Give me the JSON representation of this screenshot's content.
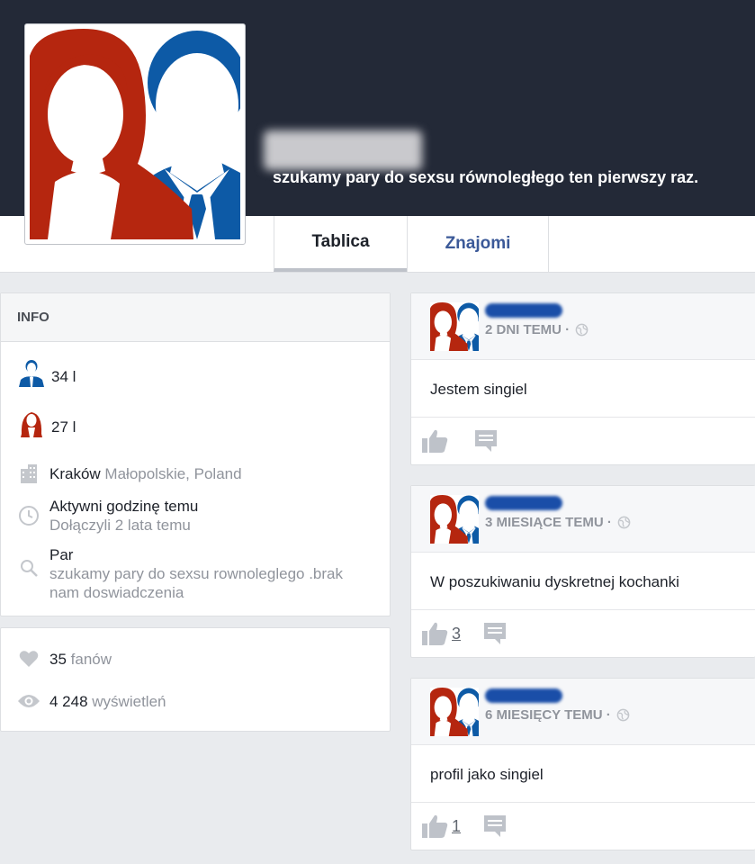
{
  "profile": {
    "tagline": "szukamy pary do sexsu równoległego ten pierwszy raz.",
    "colors": {
      "cover": "#232937",
      "woman": "#b5260f",
      "man": "#0d5aa6",
      "link": "#3b5998"
    }
  },
  "tabs": {
    "wall": "Tablica",
    "friends": "Znajomi"
  },
  "info": {
    "header": "INFO",
    "male_age": "34 l",
    "female_age": "27 l",
    "city": "Kraków",
    "region": "Małopolskie, Poland",
    "active": "Aktywni godzinę temu",
    "joined": "Dołączyli 2 lata temu",
    "type": "Par",
    "description": "szukamy pary do sexsu rownoleglego .brak nam doswiadczenia"
  },
  "stats": {
    "fans_count": "35",
    "fans_label": "fanów",
    "views_count": "4 248",
    "views_label": "wyświetleń"
  },
  "posts": [
    {
      "time": "2 DNI TEMU ·",
      "text": "Jestem singiel",
      "likes": ""
    },
    {
      "time": "3 MIESIĄCE TEMU ·",
      "text": "W poszukiwaniu dyskretnej kochanki",
      "likes": "3"
    },
    {
      "time": "6 MIESIĘCY TEMU ·",
      "text": "profil jako singiel",
      "likes": "1"
    }
  ],
  "icons": {
    "male": "male-avatar-icon",
    "female": "female-avatar-icon",
    "building": "building-icon",
    "clock": "clock-icon",
    "search": "search-icon",
    "heart": "heart-icon",
    "eye": "eye-icon",
    "globe": "globe-icon",
    "like": "thumbs-up-icon",
    "comment": "comment-icon"
  }
}
